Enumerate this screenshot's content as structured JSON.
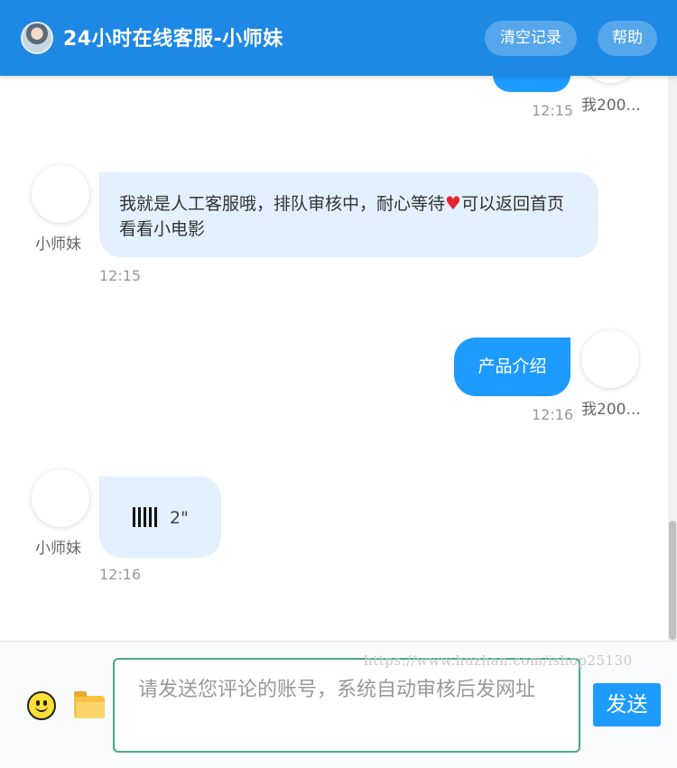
{
  "header": {
    "title": "24小时在线客服-小师妹",
    "clear_label": "清空记录",
    "help_label": "帮助"
  },
  "messages": [
    {
      "side": "out",
      "name": "我200...",
      "time": "12:15"
    },
    {
      "side": "in",
      "name": "小师妹",
      "text_before": "我就是人工客服哦，排队审核中，耐心等待",
      "emoji": "♥",
      "text_after": "可以返回首页看看小电影",
      "time": "12:15"
    },
    {
      "side": "out",
      "name": "我200...",
      "text": "产品介绍",
      "time": "12:16"
    },
    {
      "side": "in",
      "name": "小师妹",
      "voice_length": "2\"",
      "time": "12:16"
    }
  ],
  "footer": {
    "input_placeholder": "请发送您评论的账号，系统自动审核后发网址",
    "watermark": "https://www.huzhan.com/ishop25130",
    "send_label": "发送"
  },
  "colors": {
    "header_bg": "#1e88e5",
    "outgoing_bubble": "#1e9bff",
    "incoming_bubble": "#e3f0ff",
    "send_button": "#1e9bff"
  }
}
